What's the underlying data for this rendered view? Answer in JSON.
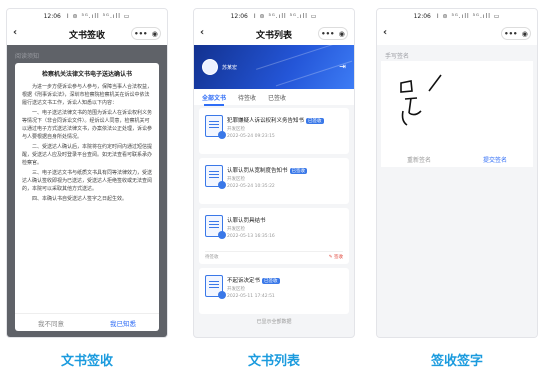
{
  "status_bar": {
    "time": "12:06",
    "signal": "Ⅰ ⊜ ⁵ᴳ.ıll ⁵ᴳ.ıll ▭"
  },
  "phone1": {
    "nav_title": "文书签收",
    "section_label": "阅读须知",
    "doc_title": "检察机关法律文书电子送达确认书",
    "paragraphs": [
      "为进一步方便诉讼参与人参与，保障当事人合法权益，根据《刑事诉讼法》，深圳市检察院检察机关在诉讼中依法履行送达文书工作，诉讼人知悉以下内容：",
      "一、电子送达法律文书的范围为诉讼人在诉讼权利义务等情况下（非合同诉讼文件）。经诉讼人同意，检察机关可以通过电子方式送达法律文书，办案依法公正处理，诉讼参与人要根据自身所处情况。",
      "二、受送达人确认后，本院将在约定时间内通过短信提醒，受送达人应及时登录平台查阅。如无法查看可联系承办检察官。",
      "三、电子送达文书与纸质文书具有同等法律效力，受送达人确认签收即视为已送达，受送达人拒绝签收或无法查阅的，本院可以采取其他方式送达。",
      "四、本确认书自受送达人签字之日起生效。"
    ],
    "disagree_label": "我不同意",
    "agree_label": "我已知悉"
  },
  "phone2": {
    "nav_title": "文书列表",
    "user_name": "苏某宏",
    "tabs": [
      "全部文书",
      "待签收",
      "已签收"
    ],
    "documents": [
      {
        "title": "犯罪嫌疑人诉讼权利义务告知书",
        "badge": "已签收",
        "sender": "开发区检",
        "time": "2022-05-24 09:23:15",
        "footer_left": "",
        "footer_right": ""
      },
      {
        "title": "认罪认罚从宽制度告知书",
        "badge": "已签收",
        "sender": "开发区检",
        "time": "2022-05-24 10:35:22",
        "footer_left": "",
        "footer_right": ""
      },
      {
        "title": "认罪认罚具结书",
        "badge": "",
        "sender": "开发区检",
        "time": "2022-05-13 16:35:16",
        "footer_left": "待签收",
        "footer_right": "✎ 签收"
      },
      {
        "title": "不起诉决定书",
        "badge": "已签收",
        "sender": "开发区检",
        "time": "2022-05-11 17:42:51",
        "footer_left": "",
        "footer_right": ""
      }
    ],
    "list_end": "已显示全部数据"
  },
  "phone3": {
    "section_label": "手写签名",
    "signature_text": "吴",
    "clear_label": "重新签名",
    "submit_label": "提交签名"
  },
  "captions": [
    "文书签收",
    "文书列表",
    "签收签字"
  ],
  "colors": {
    "accent": "#2f6df6",
    "caption": "#1b9bde",
    "banner": "#2456d8",
    "danger": "#e0453a"
  }
}
